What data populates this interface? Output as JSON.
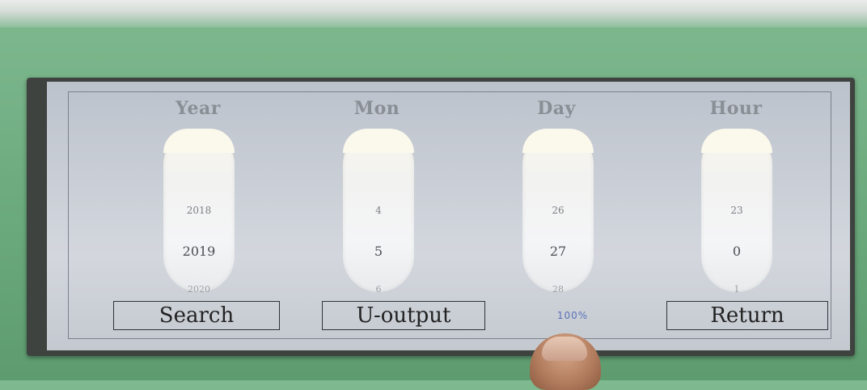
{
  "columns": [
    {
      "title": "Year",
      "prev": "2018",
      "current": "2019",
      "next": "2020"
    },
    {
      "title": "Mon",
      "prev": "4",
      "current": "5",
      "next": "6"
    },
    {
      "title": "Day",
      "prev": "26",
      "current": "27",
      "next": "28"
    },
    {
      "title": "Hour",
      "prev": "23",
      "current": "0",
      "next": "1"
    }
  ],
  "buttons": {
    "search": "Search",
    "u_output": "U-output",
    "return": "Return"
  },
  "progress": "100%"
}
